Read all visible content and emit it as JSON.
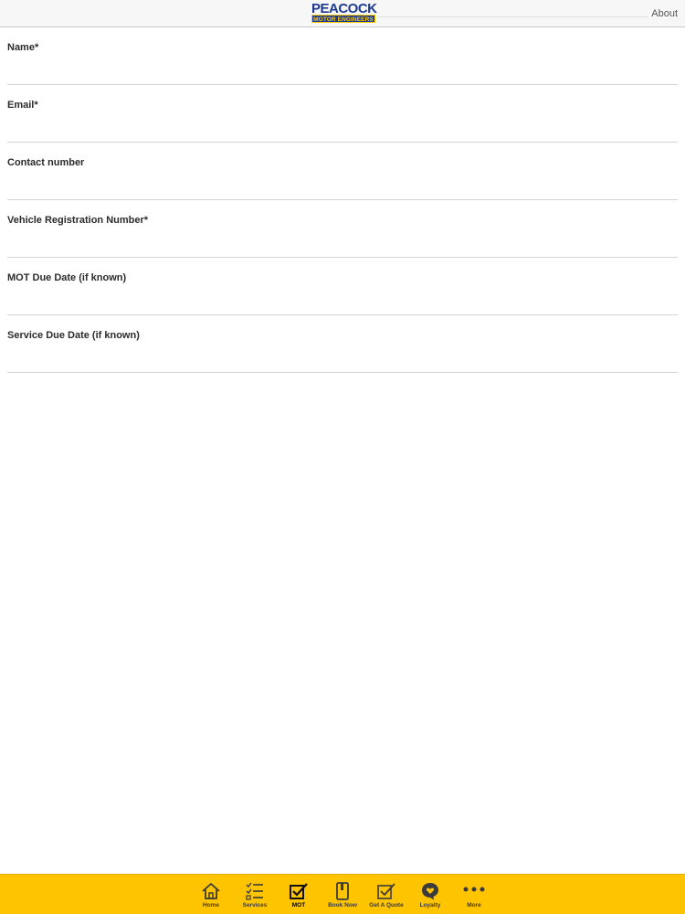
{
  "header": {
    "logo_top": "PEACOCK",
    "logo_bottom": "MOTOR ENGINEERS",
    "about_label": "About"
  },
  "form": {
    "fields": [
      {
        "label": "Name*",
        "value": ""
      },
      {
        "label": "Email*",
        "value": ""
      },
      {
        "label": "Contact number",
        "value": ""
      },
      {
        "label": "Vehicle Registration Number*",
        "value": ""
      },
      {
        "label": "MOT Due Date (if known)",
        "value": ""
      },
      {
        "label": "Service Due Date (if known)",
        "value": ""
      }
    ]
  },
  "tabbar": {
    "active": "MOT",
    "items": [
      {
        "label": "Home",
        "icon": "home-icon"
      },
      {
        "label": "Services",
        "icon": "checklist-icon"
      },
      {
        "label": "MOT",
        "icon": "checkbox-icon"
      },
      {
        "label": "Book Now",
        "icon": "book-icon"
      },
      {
        "label": "Get A Quote",
        "icon": "checkbox-icon"
      },
      {
        "label": "Loyalty",
        "icon": "heart-bubble-icon"
      },
      {
        "label": "More",
        "icon": "more-dots-icon"
      }
    ]
  },
  "colors": {
    "accent": "#ffc400",
    "brand_blue": "#1d3a8f",
    "brand_yellow": "#ffcc00"
  }
}
